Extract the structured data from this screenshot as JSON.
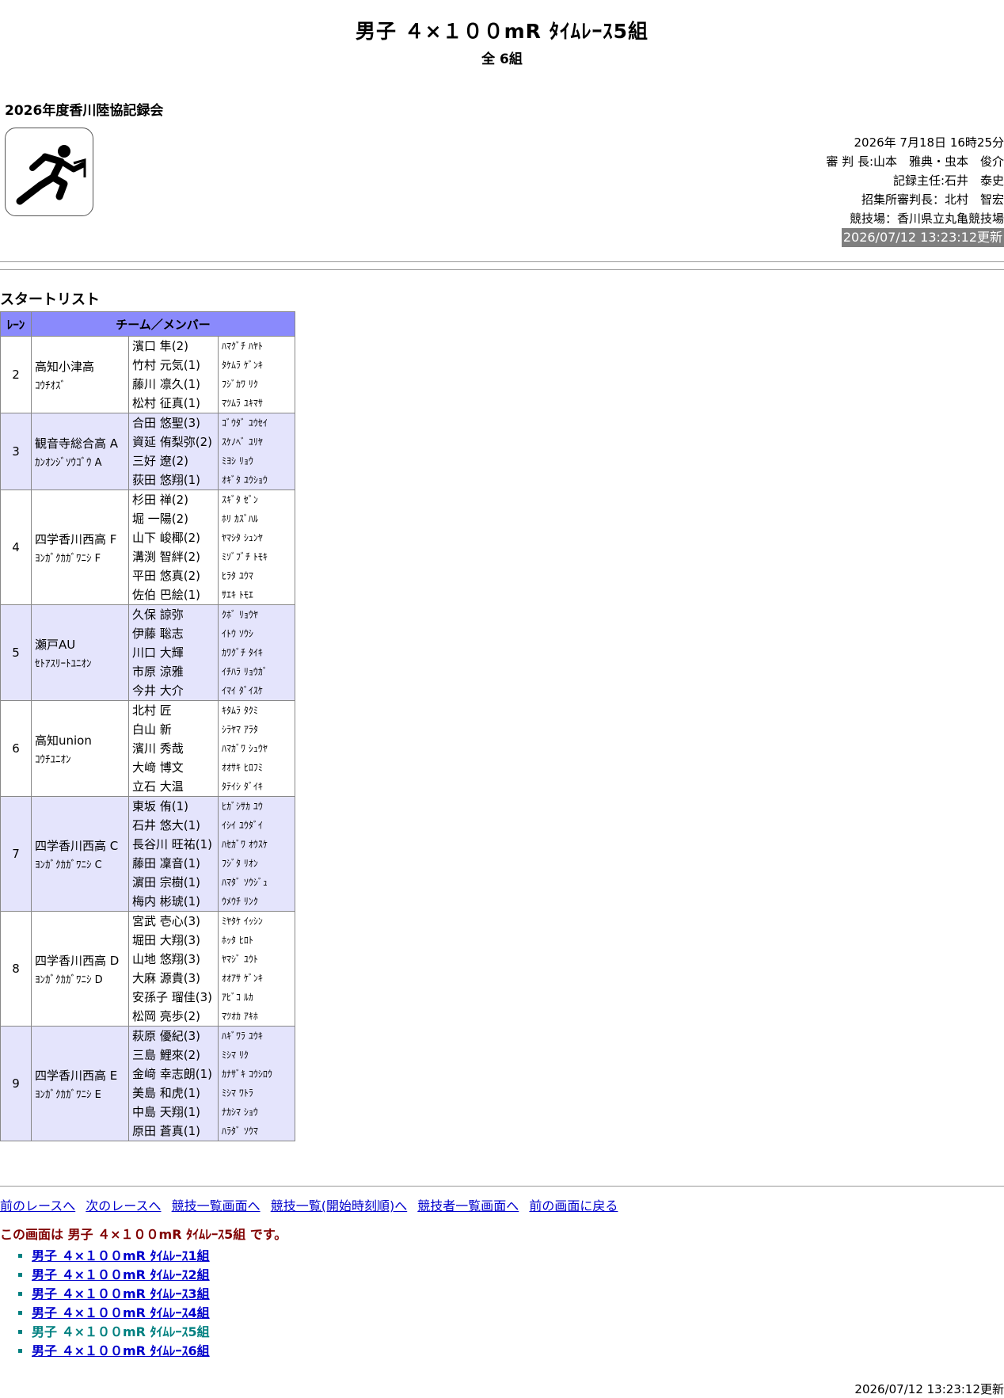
{
  "header": {
    "title": "男子 ４×１００mR ﾀｲﾑﾚｰｽ5組",
    "subtitle": "全 6組",
    "meet_name": "2026年度香川陸協記録会"
  },
  "info": {
    "datetime": "2026年 7月18日 16時25分",
    "referee": "審 判 長:山本　雅典・虫本　俊介",
    "recorder": "記録主任:石井　泰史",
    "call_referee": "招集所審判長：北村　智宏",
    "venue": "競技場：香川県立丸亀競技場",
    "updated": "2026/07/12 13:23:12更新"
  },
  "section_title": "スタートリスト",
  "table": {
    "col_lane": "ﾚｰﾝ",
    "col_team": "チーム／メンバー",
    "rows": [
      {
        "lane": "2",
        "team": "高知小津高",
        "team_kana": "ｺｳﾁｵｽﾞ",
        "members": [
          "濱口 隼(2)",
          "竹村 元気(1)",
          "藤川 凛久(1)",
          "松村 征真(1)"
        ],
        "kana": [
          "ﾊﾏｸﾞﾁ ﾊﾔﾄ",
          "ﾀｹﾑﾗ ｹﾞﾝｷ",
          "ﾌｼﾞｶﾜ ﾘｸ",
          "ﾏﾂﾑﾗ ﾕｷﾏｻ"
        ]
      },
      {
        "lane": "3",
        "team": "観音寺総合高 A",
        "team_kana": "ｶﾝｵﾝｼﾞｿｳｺﾞｳ A",
        "members": [
          "合田 悠聖(3)",
          "資延 侑梨弥(2)",
          "三好 遼(2)",
          "荻田 悠翔(1)"
        ],
        "kana": [
          "ｺﾞｳﾀﾞ ﾕｳｾｲ",
          "ｽｹﾉﾍﾞ ﾕﾘﾔ",
          "ﾐﾖｼ ﾘｮｳ",
          "ｵｷﾞﾀ ﾕｳｼｮｳ"
        ]
      },
      {
        "lane": "4",
        "team": "四学香川西高 F",
        "team_kana": "ﾖﾝｶﾞｸｶｶﾞﾜﾆｼ F",
        "members": [
          "杉田 禅(2)",
          "堀 一陽(2)",
          "山下 峻椰(2)",
          "溝渕 智絆(2)",
          "平田 悠真(2)",
          "佐伯 巴絵(1)"
        ],
        "kana": [
          "ｽｷﾞﾀ ｾﾞﾝ",
          "ﾎﾘ ｶｽﾞﾊﾙ",
          "ﾔﾏｼﾀ ｼｭﾝﾔ",
          "ﾐｿﾞﾌﾞﾁ ﾄﾓｷ",
          "ﾋﾗﾀ ﾕｳﾏ",
          "ｻｴｷ ﾄﾓｴ"
        ]
      },
      {
        "lane": "5",
        "team": "瀬戸AU",
        "team_kana": "ｾﾄｱｽﾘｰﾄﾕﾆｵﾝ",
        "members": [
          "久保 諒弥",
          "伊藤 聡志",
          "川口 大輝",
          "市原 涼雅",
          "今井 大介"
        ],
        "kana": [
          "ｸﾎﾞ ﾘｮｳﾔ",
          "ｲﾄｳ ｿｳｼ",
          "ｶﾜｸﾞﾁ ﾀｲｷ",
          "ｲﾁﾊﾗ ﾘｮｳｶﾞ",
          "ｲﾏｲ ﾀﾞｲｽｹ"
        ]
      },
      {
        "lane": "6",
        "team": "高知union",
        "team_kana": "ｺｳﾁﾕﾆｵﾝ",
        "members": [
          "北村 匠",
          "白山 新",
          "濱川 秀哉",
          "大﨑 博文",
          "立石 大温"
        ],
        "kana": [
          "ｷﾀﾑﾗ ﾀｸﾐ",
          "ｼﾗﾔﾏ ｱﾗﾀ",
          "ﾊﾏｶﾞﾜ ｼｭｳﾔ",
          "ｵｵｻｷ ﾋﾛﾌﾐ",
          "ﾀﾃｲｼ ﾀﾞｲｷ"
        ]
      },
      {
        "lane": "7",
        "team": "四学香川西高 C",
        "team_kana": "ﾖﾝｶﾞｸｶｶﾞﾜﾆｼ C",
        "members": [
          "東坂 侑(1)",
          "石井 悠大(1)",
          "長谷川 旺祐(1)",
          "藤田 凜音(1)",
          "濵田 宗樹(1)",
          "梅内 彬琥(1)"
        ],
        "kana": [
          "ﾋｶﾞｼｻｶ ﾕｳ",
          "ｲｼｲ ﾕｳﾀﾞｲ",
          "ﾊｾｶﾞﾜ ｵｳｽｹ",
          "ﾌｼﾞﾀ ﾘｵﾝ",
          "ﾊﾏﾀﾞ ｿｳｼﾞｭ",
          "ｳﾒｳﾁ ﾘﾝｸ"
        ]
      },
      {
        "lane": "8",
        "team": "四学香川西高 D",
        "team_kana": "ﾖﾝｶﾞｸｶｶﾞﾜﾆｼ D",
        "members": [
          "宮武 壱心(3)",
          "堀田 大翔(3)",
          "山地 悠翔(3)",
          "大麻 源貴(3)",
          "安孫子 瑠佳(3)",
          "松岡 亮歩(2)"
        ],
        "kana": [
          "ﾐﾔﾀｹ ｲｯｼﾝ",
          "ﾎｯﾀ ﾋﾛﾄ",
          "ﾔﾏｼﾞ ﾕｳﾄ",
          "ｵｵｱｻ ｹﾞﾝｷ",
          "ｱﾋﾞｺ ﾙｶ",
          "ﾏﾂｵｶ ｱｷﾎ"
        ]
      },
      {
        "lane": "9",
        "team": "四学香川西高 E",
        "team_kana": "ﾖﾝｶﾞｸｶｶﾞﾜﾆｼ E",
        "members": [
          "萩原 優紀(3)",
          "三島 鯉來(2)",
          "金﨑 幸志朗(1)",
          "美島 和虎(1)",
          "中島 天翔(1)",
          "原田 蒼真(1)"
        ],
        "kana": [
          "ﾊｷﾞﾜﾗ ﾕｳｷ",
          "ﾐｼﾏ ﾘｸ",
          "ｶﾅｻﾞｷ ｺｳｼﾛｳ",
          "ﾐｼﾏ ﾜﾄﾗ",
          "ﾅｶｼﾏ ｼｮｳ",
          "ﾊﾗﾀﾞ ｿｳﾏ"
        ]
      }
    ]
  },
  "nav": {
    "prev_race": "前のレースへ",
    "next_race": "次のレースへ",
    "event_list": "競技一覧画面へ",
    "event_list_time": "競技一覧(開始時刻順)へ",
    "athlete_list": "競技者一覧画面へ",
    "back": "前の画面に戻る"
  },
  "current_notice": "この画面は 男子 ４×１００mR ﾀｲﾑﾚｰｽ5組 です。",
  "races": [
    {
      "label": "男子 ４×１００mR ﾀｲﾑﾚｰｽ1組",
      "current": false
    },
    {
      "label": "男子 ４×１００mR ﾀｲﾑﾚｰｽ2組",
      "current": false
    },
    {
      "label": "男子 ４×１００mR ﾀｲﾑﾚｰｽ3組",
      "current": false
    },
    {
      "label": "男子 ４×１００mR ﾀｲﾑﾚｰｽ4組",
      "current": false
    },
    {
      "label": "男子 ４×１００mR ﾀｲﾑﾚｰｽ5組",
      "current": true
    },
    {
      "label": "男子 ４×１００mR ﾀｲﾑﾚｰｽ6組",
      "current": false
    }
  ],
  "footer_updated": "2026/07/12 13:23:12更新"
}
